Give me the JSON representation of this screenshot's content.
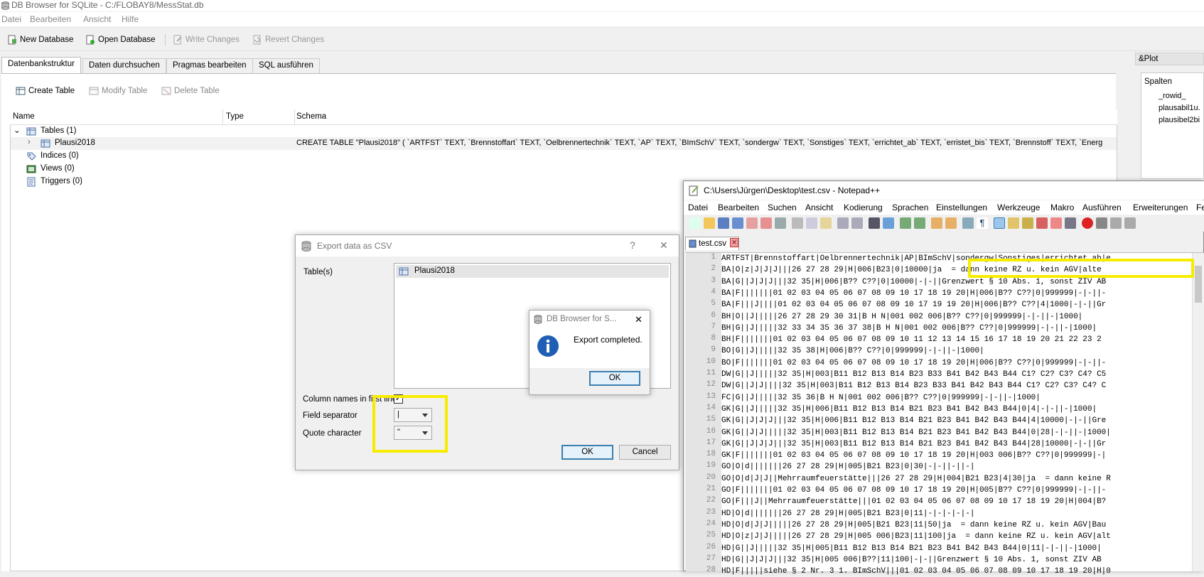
{
  "window": {
    "title": "DB Browser for SQLite - C:/FLOBAY8/MessStat.db"
  },
  "menu": [
    "Datei",
    "Bearbeiten",
    "Ansicht",
    "Hilfe"
  ],
  "toolbar": {
    "new_db": "New Database",
    "open_db": "Open Database",
    "write_changes": "Write Changes",
    "revert_changes": "Revert Changes"
  },
  "tabs": [
    "Datenbankstruktur",
    "Daten durchsuchen",
    "Pragmas bearbeiten",
    "SQL ausführen"
  ],
  "structure": {
    "create_table": "Create Table",
    "modify_table": "Modify Table",
    "delete_table": "Delete Table",
    "columns": {
      "name": "Name",
      "type": "Type",
      "schema": "Schema"
    },
    "tables_label": "Tables (1)",
    "table_name": "Plausi2018",
    "table_schema": "CREATE TABLE \"Plausi2018\" ( `ARTFST` TEXT, `Brennstoffart` TEXT, `Oelbrennertechnik` TEXT, `AP` TEXT, `BImSchV` TEXT, `sondergw` TEXT, `Sonstiges` TEXT, `errichtet_ab` TEXT, `erristet_bis` TEXT, `Brennstoff` TEXT, `Energ",
    "indices_label": "Indices (0)",
    "views_label": "Views (0)",
    "triggers_label": "Triggers (0)"
  },
  "plot_panel": {
    "title": "&Plot",
    "columns_label": "Spalten",
    "columns": [
      "_rowid_",
      "plausabil1u.",
      "plausibel2bi"
    ]
  },
  "export_dialog": {
    "title": "Export data as CSV",
    "help": "?",
    "close": "✕",
    "tables_label": "Table(s)",
    "table_item": "Plausi2018",
    "column_names_label": "Column names in first line",
    "column_names_checked": true,
    "field_separator_label": "Field separator",
    "field_separator_value": "|",
    "quote_char_label": "Quote character",
    "quote_char_value": "\"",
    "ok": "OK",
    "cancel": "Cancel"
  },
  "message_box": {
    "title": "DB Browser for S...",
    "close": "✕",
    "text": "Export completed.",
    "ok": "OK"
  },
  "notepad": {
    "title": "C:\\Users\\Jürgen\\Desktop\\test.csv - Notepad++",
    "menu": [
      "Datei",
      "Bearbeiten",
      "Suchen",
      "Ansicht",
      "Kodierung",
      "Sprachen",
      "Einstellungen",
      "Werkzeuge",
      "Makro",
      "Ausführen",
      "Erweiterungen",
      "Fe"
    ],
    "tab_name": "test.csv",
    "lines": [
      "ARTFST|Brennstoffart|Oelbrennertechnik|AP|BImSchV|sondergw|Sonstiges|errichtet_ab|e",
      "BA|O|z|J|J|J|||26 27 28 29|H|006|B23|0|10000|ja  = dann keine RZ u. kein AGV|alte",
      "BA|G||J|J|J|||32 35|H|006|B?? C??|0|10000|-|-||Grenzwert § 10 Abs. 1, sonst ZIV AB",
      "BA|F|||||||01 02 03 04 05 06 07 08 09 10 17 18 19 20|H|006|B?? C??|0|999999|-|-||-",
      "BA|F|||J||||01 02 03 04 05 06 07 08 09 10 17 19 19 20|H|006|B?? C??|4|1000|-|-||Gr",
      "BH|O||J|||||26 27 28 29 30 31|B H N|001 002 006|B?? C??|0|999999|-|-||-|1000|",
      "BH|G||J|||||32 33 34 35 36 37 38|B H N|001 002 006|B?? C??|0|999999|-|-||-|1000|",
      "BH|F|||||||01 02 03 04 05 06 07 08 09 10 11 12 13 14 15 16 17 18 19 20 21 22 23 2",
      "BO|G||J|||||32 35 38|H|006|B?? C??|0|999999|-|-||-|1000|",
      "BO|F|||||||01 02 03 04 05 06 07 08 09 10 17 18 19 20|H|006|B?? C??|0|999999|-|-||-",
      "DW|G||J|||||32 35|H|003|B11 B12 B13 B14 B23 B33 B41 B42 B43 B44 C1? C2? C3? C4? C5",
      "DW|G||J|J||||32 35|H|003|B11 B12 B13 B14 B23 B33 B41 B42 B43 B44 C1? C2? C3? C4? C",
      "FC|G||J|||||32 35 36|B H N|001 002 006|B?? C??|0|999999|-|-||-|1000|",
      "GK|G||J|||||32 35|H|006|B11 B12 B13 B14 B21 B23 B41 B42 B43 B44|0|4|-|-||-|1000|",
      "GK|G||J|J|J|||32 35|H|006|B11 B12 B13 B14 B21 B23 B41 B42 B43 B44|4|10000|-|-||Gre",
      "GK|G||J|J|||||32 35|H|003|B11 B12 B13 B14 B21 B23 B41 B42 B43 B44|0|28|-|-||-|1000|",
      "GK|G||J|J|J|||32 35|H|003|B11 B12 B13 B14 B21 B23 B41 B42 B43 B44|28|10000|-|-||Gr",
      "GK|F|||||||01 02 03 04 05 06 07 08 09 10 17 18 19 20|H|003 006|B?? C??|0|999999|-|",
      "GO|O|d|||||||26 27 28 29|H|005|B21 B23|0|30|-|-||-||-|",
      "GO|O|d|J|J||Mehrraumfeuerstätte|||26 27 28 29|H|004|B21 B23|4|30|ja  = dann keine R",
      "GO|F|||||||01 02 03 04 05 06 07 08 09 10 17 18 19 20|H|005|B?? C??|0|999999|-|-||-",
      "GO|F|||J||Mehrraumfeuerstätte|||01 02 03 04 05 06 07 08 09 10 17 18 19 20|H|004|B?",
      "HD|O|d|||||||26 27 28 29|H|005|B21 B23|0|11|-|-|-|-|-|",
      "HD|O|d|J|J|||||26 27 28 29|H|005|B21 B23|11|50|ja  = dann keine RZ u. kein AGV|Bau",
      "HD|O|z|J|J|||||26 27 28 29|H|005 006|B23|11|100|ja  = dann keine RZ u. kein AGV|alt",
      "HD|G||J|||||32 35|H|005|B11 B12 B13 B14 B21 B23 B41 B42 B43 B44|0|11|-|-||-|1000|",
      "HD|G||J|J|J|||32 35|H|005 006|B??|11|100|-|-||Grenzwert § 10 Abs. 1, sonst ZIV AB",
      "HD|F|||||siehe § 2 Nr. 3 1. BImSchV|||01 02 03 04 05 06 07 08 09 10 17 18 19 20|H|0"
    ]
  },
  "colors": {
    "highlight": "#f7ec00",
    "accent": "#3c7fb1"
  }
}
